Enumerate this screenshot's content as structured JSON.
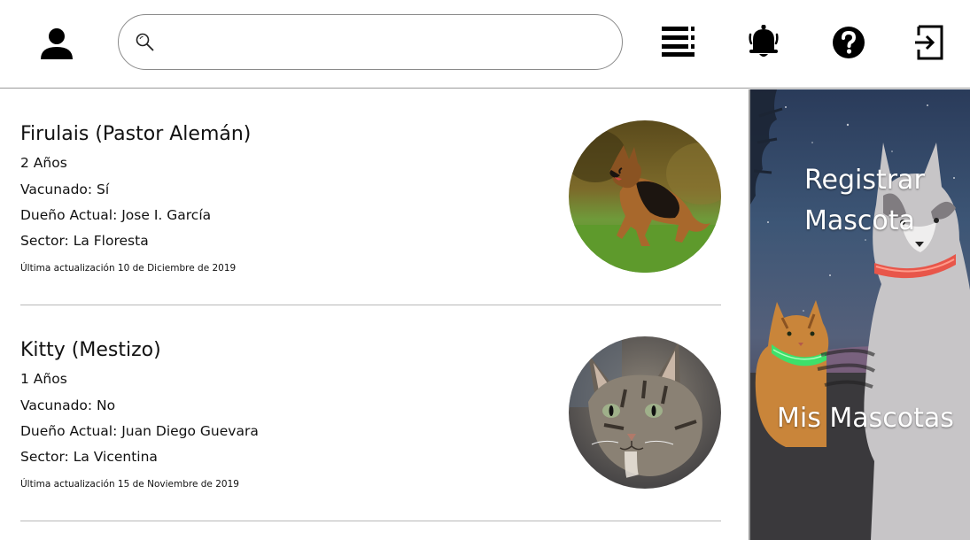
{
  "header": {
    "search": {
      "value": "",
      "placeholder": ""
    },
    "icons": [
      "user-icon",
      "search-icon",
      "menu-list-icon",
      "bell-icon",
      "help-icon",
      "logout-icon"
    ]
  },
  "pets": [
    {
      "name": "Firulais (Pastor Alemán)",
      "age": "2 Años",
      "vaccinated": "Vacunado: Sí",
      "owner": "Dueño Actual: Jose I. García",
      "sector": "Sector: La Floresta",
      "updated": "Última actualización 10 de Diciembre de 2019",
      "photo": "german-shepherd-photo"
    },
    {
      "name": "Kitty (Mestizo)",
      "age": "1 Años",
      "vaccinated": "Vacunado: No",
      "owner": "Dueño Actual: Juan Diego Guevara",
      "sector": "Sector: La Vicentina",
      "updated": "Última actualización 15 de Noviembre de 2019",
      "photo": "tabby-cat-photo"
    }
  ],
  "sidebar": {
    "register_line1": "Registrar",
    "register_line2": "Mascota",
    "my_pets": "Mis Mascotas",
    "background": "husky-and-cat-night-sky-image"
  },
  "colors": {
    "icon": "#000000",
    "divider": "#b9b9b9",
    "sidebar_text": "#ffffff"
  }
}
